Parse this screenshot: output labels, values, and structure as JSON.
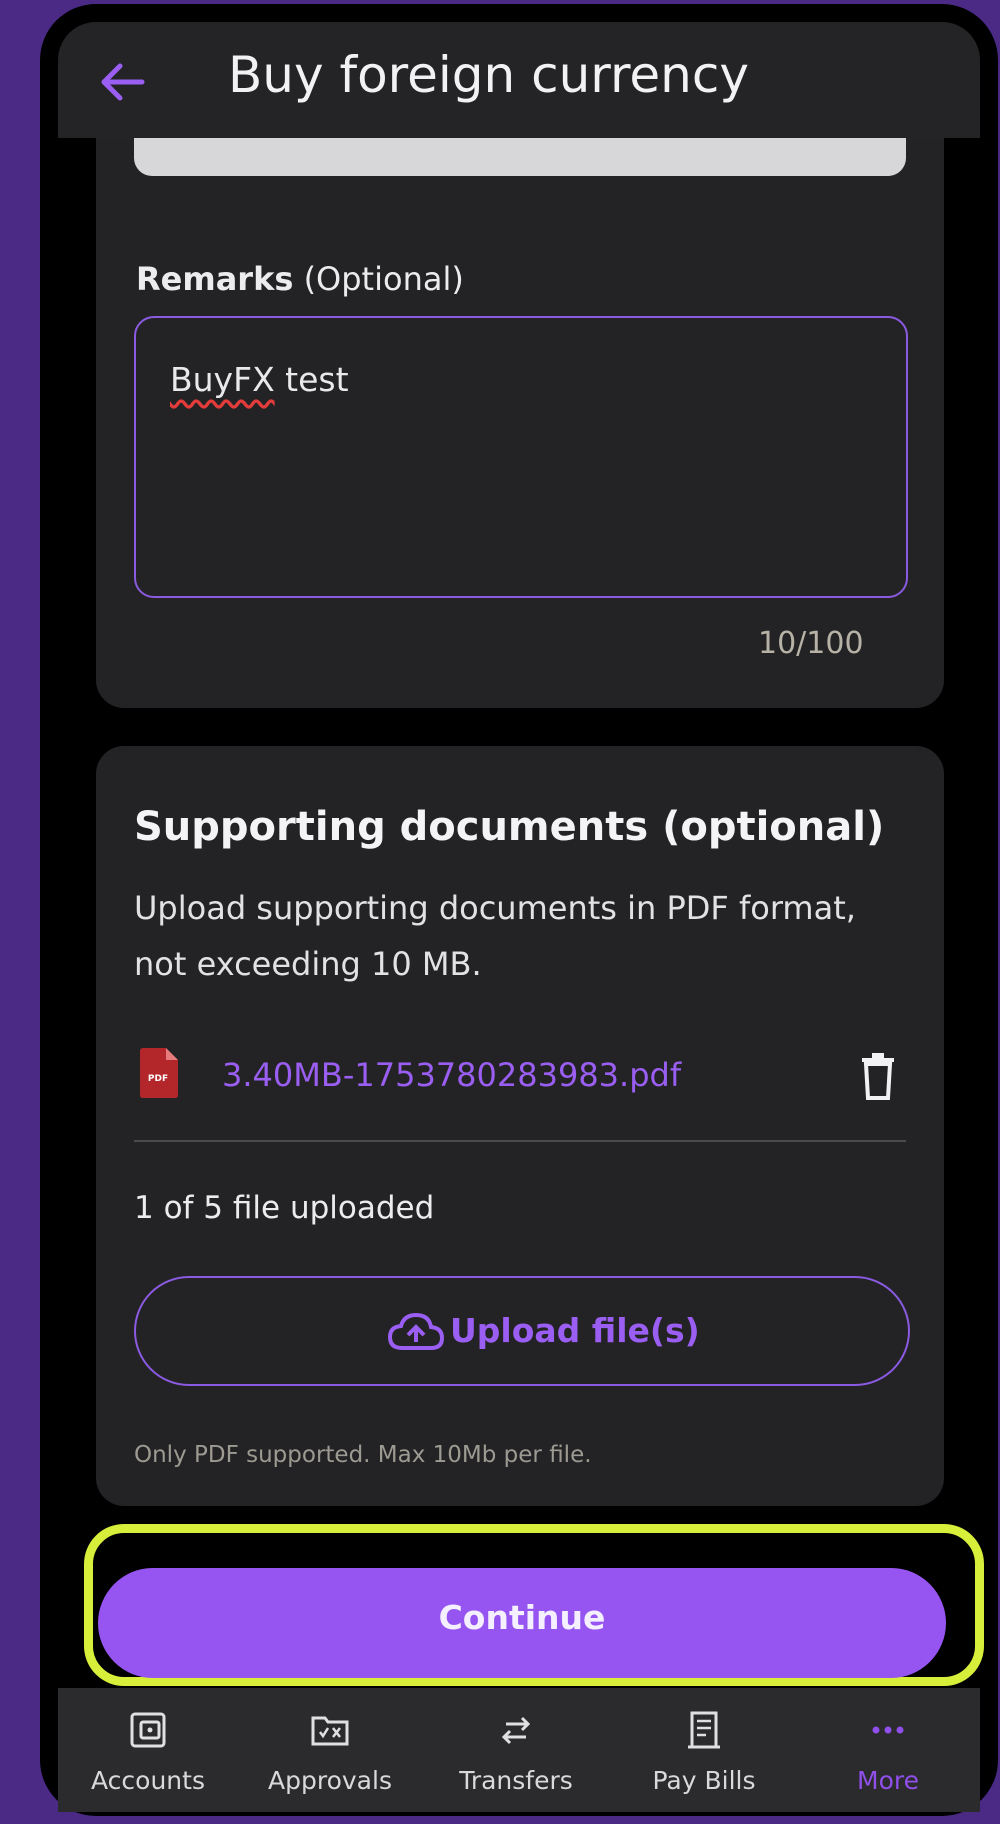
{
  "header": {
    "title": "Buy foreign currency"
  },
  "remarks": {
    "label_bold": "Remarks",
    "label_optional": "(Optional)",
    "value_misspelled": "BuyFX",
    "value_rest": " test",
    "counter": "10/100"
  },
  "supporting_documents": {
    "title": "Supporting documents (optional)",
    "description": "Upload supporting documents in PDF format, not exceeding 10 MB.",
    "file_name": "3.40MB-1753780283983.pdf",
    "upload_count": "1 of 5 file uploaded",
    "upload_label": "Upload file(s)",
    "hint": "Only PDF supported. Max 10Mb per file."
  },
  "continue_label": "Continue",
  "nav": {
    "items": [
      {
        "label": "Accounts",
        "icon": "accounts-icon"
      },
      {
        "label": "Approvals",
        "icon": "approvals-icon"
      },
      {
        "label": "Transfers",
        "icon": "transfers-icon"
      },
      {
        "label": "Pay Bills",
        "icon": "pay-bills-icon"
      },
      {
        "label": "More",
        "icon": "more-icon",
        "active": true
      }
    ]
  },
  "colors": {
    "accent": "#9655f1",
    "highlight": "#d7ee3a",
    "card": "#232325",
    "background": "#4b2a86"
  }
}
